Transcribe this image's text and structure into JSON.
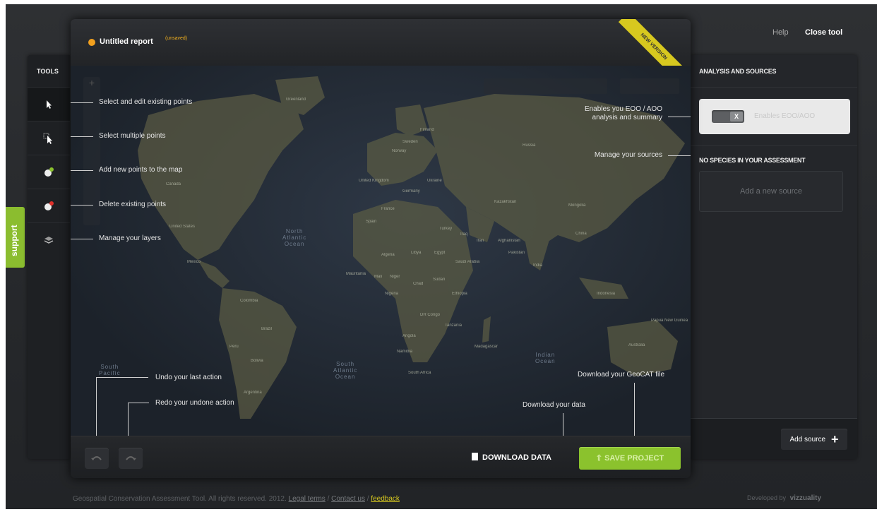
{
  "topnav": {
    "help": "Help",
    "close_tool": "Close tool"
  },
  "tools": {
    "title": "TOOLS",
    "items": [
      {
        "icon": "arrow-pointer-icon"
      },
      {
        "icon": "multi-select-icon"
      },
      {
        "icon": "add-point-icon"
      },
      {
        "icon": "delete-point-icon"
      },
      {
        "icon": "layers-icon"
      }
    ]
  },
  "support": "support",
  "report": {
    "title": "Untitled report",
    "status": "(unsaved)",
    "ribbon": "NEW VERSION"
  },
  "annotations": {
    "select_edit": "Select and edit existing points",
    "select_multiple": "Select multiple points",
    "add_points": "Add new points to the map",
    "delete_points": "Delete existing points",
    "manage_layers": "Manage your layers",
    "eoo_line1": "Enables you EOO / AOO",
    "eoo_line2": "analysis and summary",
    "manage_sources": "Manage your sources",
    "undo": "Undo your last action",
    "redo": "Redo your undone action",
    "download_data": "Download your data",
    "download_geocat": "Download your GeoCAT file"
  },
  "map": {
    "oceans": [
      {
        "line1": "North",
        "line2": "Atlantic",
        "line3": "Ocean"
      },
      {
        "line1": "South",
        "line2": "Atlantic",
        "line3": "Ocean"
      },
      {
        "line1": "South",
        "line2": "Pacific",
        "line3": ""
      },
      {
        "line1": "Indian",
        "line2": "Ocean",
        "line3": ""
      }
    ],
    "places": [
      "Greenland",
      "Canada",
      "United States",
      "Mexico",
      "Brazil",
      "Peru",
      "Colombia",
      "Bolivia",
      "Argentina",
      "Russia",
      "Kazakhstan",
      "Mongolia",
      "China",
      "India",
      "Iran",
      "Saudi Arabia",
      "Egypt",
      "Algeria",
      "Libya",
      "Mali",
      "Niger",
      "Chad",
      "Sudan",
      "Nigeria",
      "Ethiopia",
      "DR Congo",
      "Tanzania",
      "Angola",
      "Namibia",
      "South Africa",
      "Madagascar",
      "Australia",
      "Indonesia",
      "Ukraine",
      "Germany",
      "France",
      "Spain",
      "Sweden",
      "Finland",
      "Norway",
      "United Kingdom",
      "Turkey",
      "Iraq",
      "Afghanistan",
      "Pakistan",
      "Mauritania",
      "Papua New Guinea"
    ]
  },
  "analysis": {
    "title": "ANALYSIS AND SOURCES",
    "eoo_toggle": "Enables EOO/AOO",
    "toggle_mark": "X",
    "no_species": "NO SPECIES IN YOUR ASSESSMENT",
    "add_new_source": "Add a new source",
    "add_source_button": "Add source",
    "add_icon": "+"
  },
  "footer_bar": {
    "undo_icon": "undo-arrow-icon",
    "redo_icon": "redo-arrow-icon",
    "download_data": "DOWNLOAD DATA",
    "save_project": "SAVE PROJECT"
  },
  "footer": {
    "copyright": "Geospatial Conservation Assessment Tool. All rights reserved. 2012.",
    "legal": "Legal terms",
    "sep1": "/",
    "contact": "Contact us",
    "sep2": "/",
    "feedback": "feedback",
    "developed_by": "Developed by",
    "developer": "vizzuality"
  },
  "colors": {
    "accent_green": "#8bc22d",
    "unsaved_orange": "#f2a01e",
    "ribbon_yellow": "#d7c81f"
  }
}
